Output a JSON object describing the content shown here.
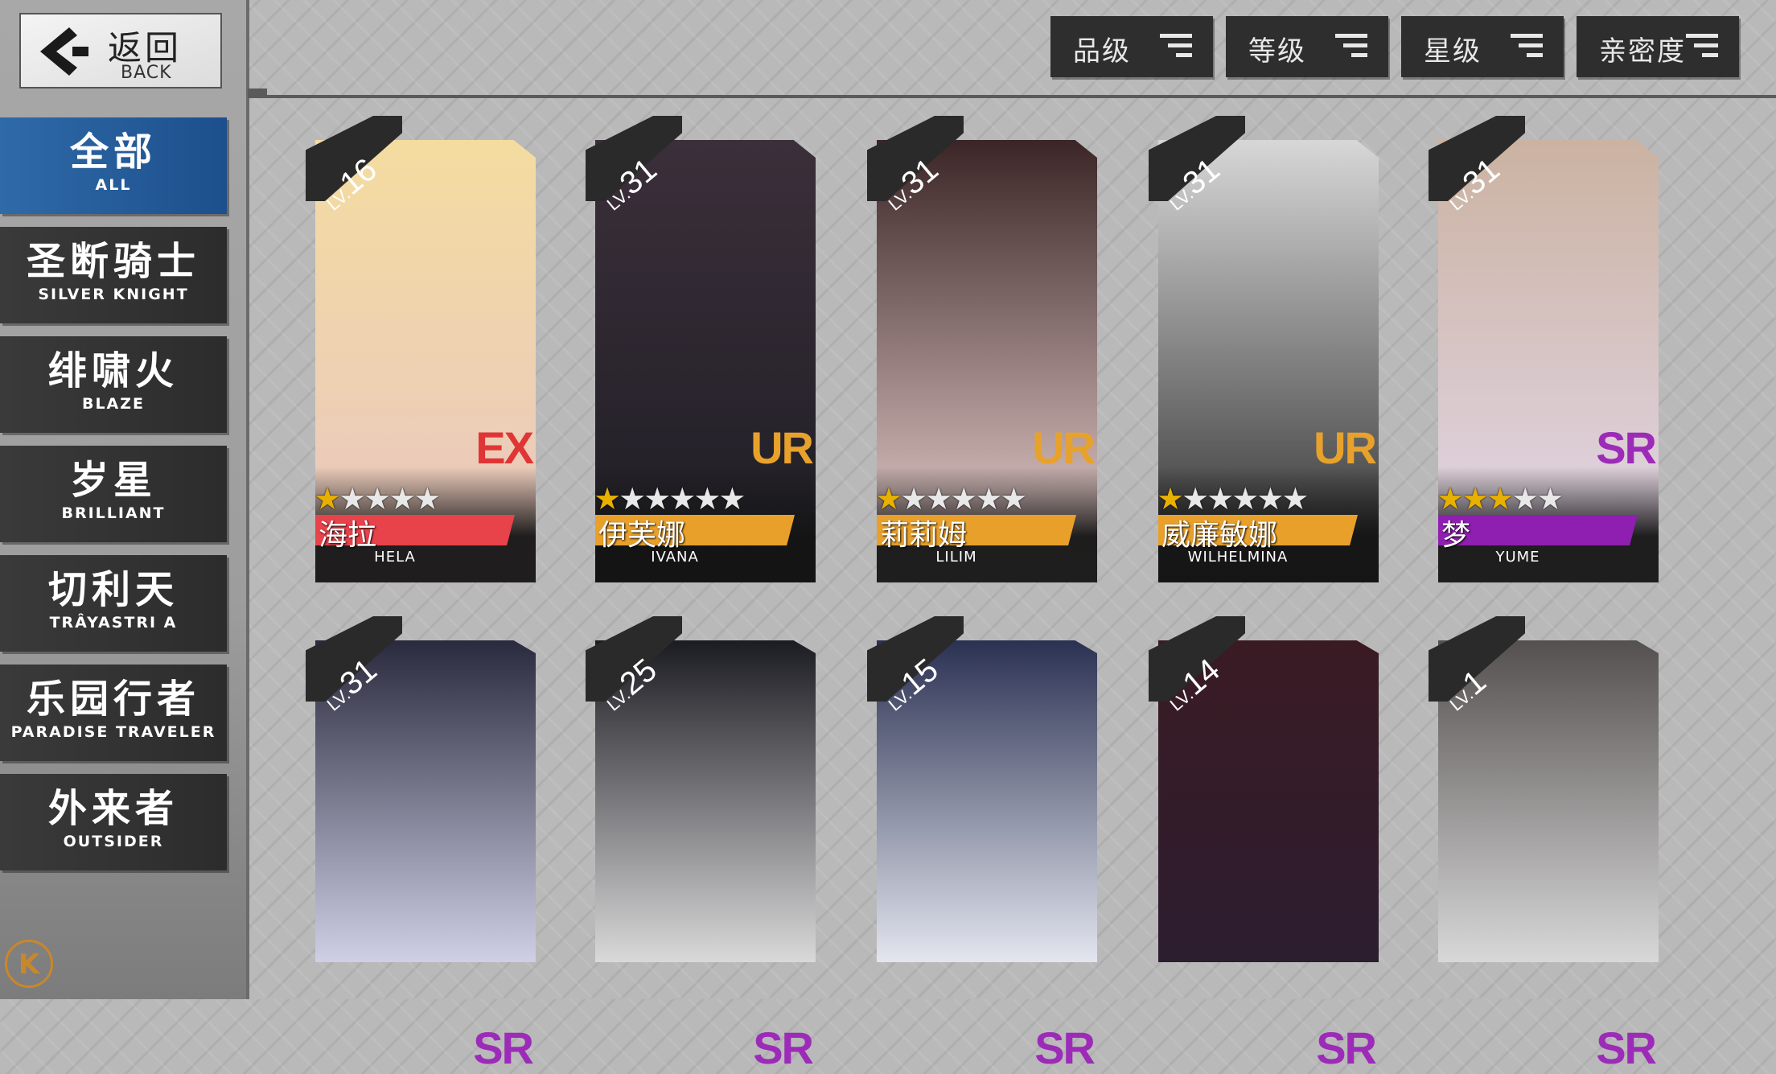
{
  "back": {
    "zh": "返回",
    "en": "BACK"
  },
  "categories": [
    {
      "zh": "全部",
      "en": "ALL",
      "active": true
    },
    {
      "zh": "圣断骑士",
      "en": "SILVER KNIGHT"
    },
    {
      "zh": "绯啸火",
      "en": "BLAZE"
    },
    {
      "zh": "岁星",
      "en": "BRILLIANT"
    },
    {
      "zh": "切利天",
      "en": "TRÂYASTRI A"
    },
    {
      "zh": "乐园行者",
      "en": "PARADISE TRAVELER"
    },
    {
      "zh": "外来者",
      "en": "OUTSIDER"
    }
  ],
  "sort_buttons": [
    "品级",
    "等级",
    "星级",
    "亲密度"
  ],
  "lv_prefix": "LV.",
  "bottom_icon": "K",
  "colors": {
    "ex": "#e03535",
    "ur": "#e8a22c",
    "sr": "#9c2bb8",
    "band_ex": "#e8424a",
    "band_ur": "#e8a02a",
    "band_sr": "#8f1fb0"
  },
  "characters": [
    {
      "level": "16",
      "rarity": "EX",
      "stars": 1,
      "max_stars": 5,
      "name_zh": "海拉",
      "name_en": "HELA",
      "art_top": "#f4dca0",
      "art_bottom": "#e9c6c2"
    },
    {
      "level": "31",
      "rarity": "UR",
      "stars": 1,
      "max_stars": 6,
      "name_zh": "伊芙娜",
      "name_en": "IVANA",
      "art_top": "#3b2f3a",
      "art_bottom": "#1d1d24"
    },
    {
      "level": "31",
      "rarity": "UR",
      "stars": 1,
      "max_stars": 6,
      "name_zh": "莉莉姆",
      "name_en": "LILIM",
      "art_top": "#3b2526",
      "art_bottom": "#f1d9d6"
    },
    {
      "level": "31",
      "rarity": "UR",
      "stars": 1,
      "max_stars": 6,
      "name_zh": "威廉敏娜",
      "name_en": "WILHELMINA",
      "art_top": "#d7d7d7",
      "art_bottom": "#2a2a2a"
    },
    {
      "level": "31",
      "rarity": "SR",
      "stars": 3,
      "max_stars": 5,
      "name_zh": "梦",
      "name_en": "YUME",
      "art_top": "#cbb2a1",
      "art_bottom": "#e4d9ec"
    },
    {
      "level": "31",
      "rarity": "SR",
      "name_zh": "",
      "name_en": "",
      "art_top": "#2a2a3e",
      "art_bottom": "#cfcfe5"
    },
    {
      "level": "25",
      "rarity": "SR",
      "name_zh": "",
      "name_en": "",
      "art_top": "#1b1b22",
      "art_bottom": "#d9d9d9"
    },
    {
      "level": "15",
      "rarity": "SR",
      "name_zh": "",
      "name_en": "",
      "art_top": "#2b3152",
      "art_bottom": "#e3e6ef"
    },
    {
      "level": "14",
      "rarity": "SR",
      "name_zh": "",
      "name_en": "",
      "art_top": "#3a1b24",
      "art_bottom": "#2c1d2f"
    },
    {
      "level": "1",
      "rarity": "SR",
      "name_zh": "",
      "name_en": "",
      "art_top": "#555050",
      "art_bottom": "#d8d8d8"
    }
  ]
}
